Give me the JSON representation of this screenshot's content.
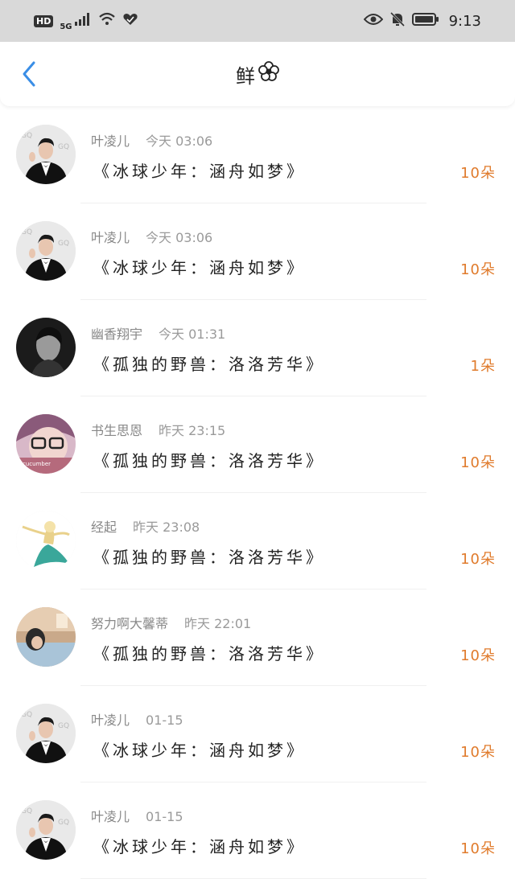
{
  "status_bar": {
    "hd": "HD",
    "network": "5G",
    "time": "9:13"
  },
  "header": {
    "title": "鲜",
    "title_icon": "flower-icon"
  },
  "colors": {
    "accent_back": "#3a8ee6",
    "amount": "#e07b2c"
  },
  "items": [
    {
      "user": "叶凌儿",
      "time": "今天 03:06",
      "book": "《冰球少年：涵舟如梦》",
      "amount": "10朵",
      "avatar": "avatar-tuxedo"
    },
    {
      "user": "叶凌儿",
      "time": "今天 03:06",
      "book": "《冰球少年：涵舟如梦》",
      "amount": "10朵",
      "avatar": "avatar-tuxedo"
    },
    {
      "user": "幽香翔宇",
      "time": "今天 01:31",
      "book": "《孤独的野兽：洛洛芳华》",
      "amount": "1朵",
      "avatar": "avatar-bw"
    },
    {
      "user": "书生思恩",
      "time": "昨天 23:15",
      "book": "《孤独的野兽：洛洛芳华》",
      "amount": "10朵",
      "avatar": "avatar-glasses"
    },
    {
      "user": "经起",
      "time": "昨天 23:08",
      "book": "《孤独的野兽：洛洛芳华》",
      "amount": "10朵",
      "avatar": "avatar-cartoon"
    },
    {
      "user": "努力啊大馨蒂",
      "time": "昨天 22:01",
      "book": "《孤独的野兽：洛洛芳华》",
      "amount": "10朵",
      "avatar": "avatar-room"
    },
    {
      "user": "叶凌儿",
      "time": "01-15",
      "book": "《冰球少年：涵舟如梦》",
      "amount": "10朵",
      "avatar": "avatar-tuxedo"
    },
    {
      "user": "叶凌儿",
      "time": "01-15",
      "book": "《冰球少年：涵舟如梦》",
      "amount": "10朵",
      "avatar": "avatar-tuxedo"
    }
  ]
}
